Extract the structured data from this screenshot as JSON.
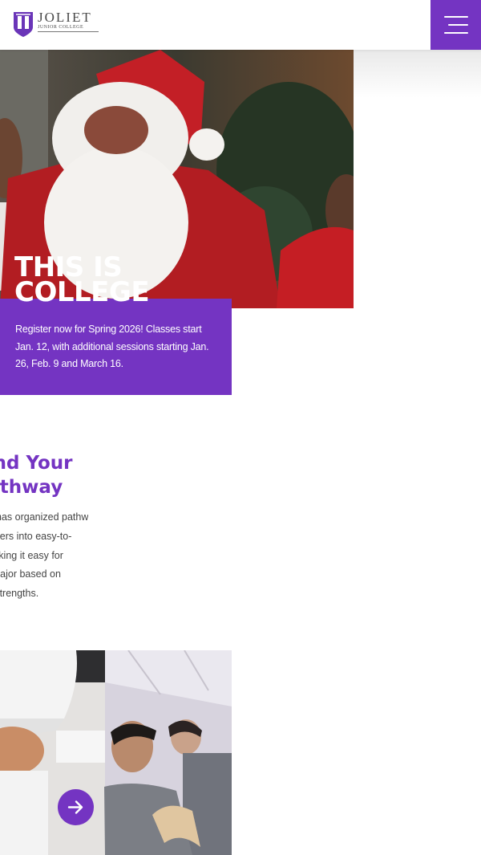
{
  "header": {
    "logo_name": "JOLIET",
    "logo_sub": "JUNIOR COLLEGE",
    "logo_icon": "jjc-shield-logo",
    "menu_icon": "hamburger-menu-icon"
  },
  "hero": {
    "title_line1": "THIS IS",
    "title_line2": "COLLEGE",
    "image": "santa-claus-with-children-photo"
  },
  "promo": {
    "text": "Register now for Spring 2026! Classes start Jan. 12, with additional sessions starting Jan. 26, Feb. 9 and March 16."
  },
  "pathway": {
    "heading_line1": "Find Your",
    "heading_line2": "Pathway",
    "body_lines": [
      "JJC has organized pathways that",
      "group careers into easy-to-",
      "navigate areas, making it easy for",
      "you to choose a major based on",
      "your interests & strengths."
    ]
  },
  "photo": {
    "image": "culinary-and-students-collage",
    "button_icon": "arrow-right-icon"
  },
  "colors": {
    "brand_purple": "#7434c2",
    "text_gray": "#444444"
  }
}
